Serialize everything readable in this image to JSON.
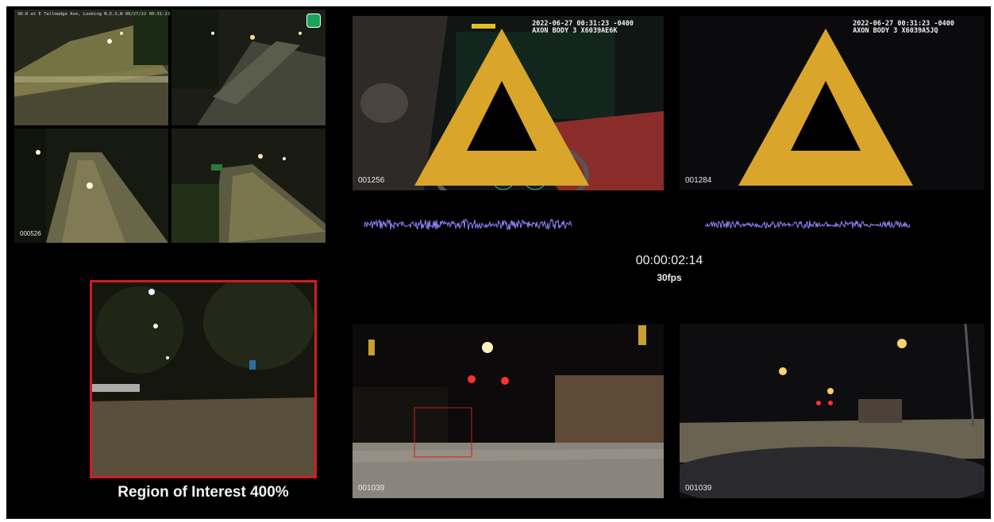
{
  "traffic_cam": {
    "title": "SR-8 at E Tallmadge Ave, Looking N,E,S,W 06/27/22 00:31:23",
    "frame": "000526",
    "icon": "traffic-camera-icon"
  },
  "bodycam_1": {
    "date": "2022-06-27 00:31:23 -0400",
    "device": "AXON BODY 3 X6039AE6K",
    "frame": "001256",
    "logo": "axon-logo-icon"
  },
  "bodycam_2": {
    "date": "2022-06-27 00:31:23 -0400",
    "device": "AXON BODY 3 X6039A5JQ",
    "frame": "001284",
    "logo": "axon-logo-icon"
  },
  "timecode": {
    "time": "00:00:02:14",
    "fps": "30fps"
  },
  "region_of_interest": {
    "caption": "Region of Interest 400%",
    "border_color": "#d31c1c"
  },
  "dashcam_1": {
    "frame": "001039"
  },
  "dashcam_2": {
    "frame": "001039"
  },
  "colors": {
    "background": "#000000",
    "waveform": "#8e88ff",
    "roi_red": "#d31c1c"
  }
}
